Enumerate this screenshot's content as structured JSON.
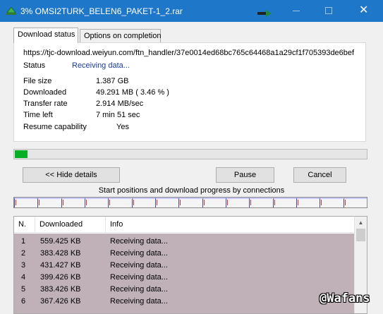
{
  "titlebar": {
    "title": "3% OMSI2TURK_BELEN6_PAKET-1_2.rar",
    "close_glyph": "✕"
  },
  "tabs": {
    "download_status": "Download status",
    "options_on_completion": "Options on completion"
  },
  "status_panel": {
    "url": "https://tjc-download.weiyun.com/ftn_handler/37e0014ed68bc765c64468a1a29cf1f705393de6bef",
    "status_label": "Status",
    "status_value": "Receiving data...",
    "file_size_label": "File size",
    "file_size_value": "1.387  GB",
    "downloaded_label": "Downloaded",
    "downloaded_value": "49.291  MB  ( 3.46 % )",
    "transfer_rate_label": "Transfer rate",
    "transfer_rate_value": "2.914  MB/sec",
    "time_left_label": "Time left",
    "time_left_value": "7 min 51 sec",
    "resume_label": "Resume capability",
    "resume_value": "Yes"
  },
  "progress": {
    "fraction": 0.0346,
    "fill_color": "#06b025"
  },
  "buttons": {
    "hide_details": "<< Hide details",
    "pause": "Pause",
    "cancel": "Cancel"
  },
  "connections": {
    "caption": "Start positions and download progress by connections",
    "segment_count": 15
  },
  "connection_list": {
    "columns": [
      "N.",
      "Downloaded",
      "Info"
    ],
    "rows": [
      {
        "n": "1",
        "downloaded": "559.425  KB",
        "info": "Receiving data..."
      },
      {
        "n": "2",
        "downloaded": "383.428  KB",
        "info": "Receiving data..."
      },
      {
        "n": "3",
        "downloaded": "431.427  KB",
        "info": "Receiving data..."
      },
      {
        "n": "4",
        "downloaded": "399.426  KB",
        "info": "Receiving data..."
      },
      {
        "n": "5",
        "downloaded": "383.426  KB",
        "info": "Receiving data..."
      },
      {
        "n": "6",
        "downloaded": "367.426  KB",
        "info": "Receiving data..."
      }
    ],
    "row_background": "#c0b1b8"
  },
  "watermark": "@Wafans",
  "colors": {
    "titlebar": "#1f77c9",
    "status_text": "#1a3a9c"
  }
}
